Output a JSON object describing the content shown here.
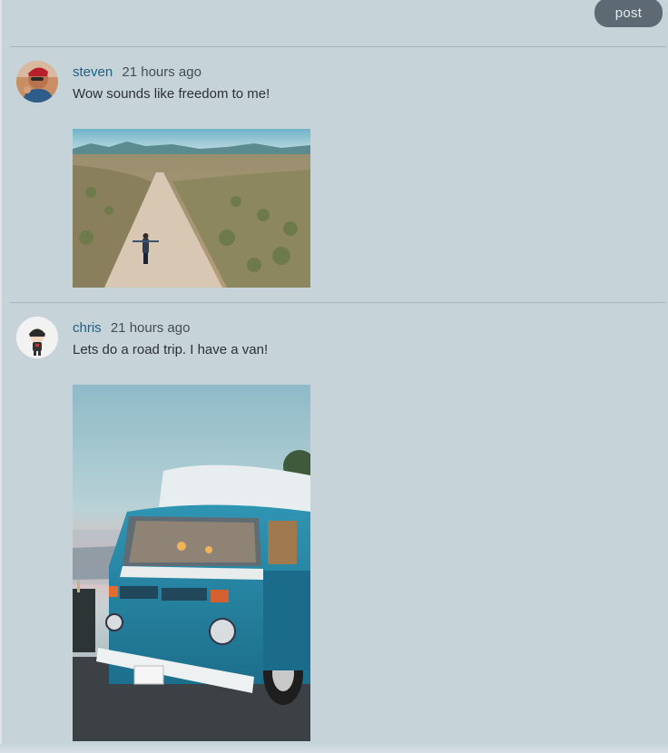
{
  "header": {
    "post_label": "post"
  },
  "posts": [
    {
      "username": "steven",
      "time": "21 hours ago",
      "text": "Wow sounds like freedom to me!",
      "image_subject": "woman walking on desert dirt road"
    },
    {
      "username": "chris",
      "time": "21 hours ago",
      "text": "Lets do a road trip. I have a van!",
      "image_subject": "blue vintage camper van at sunset"
    }
  ],
  "colors": {
    "background": "#c6d4da",
    "post_button": "#5d6a74",
    "username": "#1f5f84",
    "divider": "#a9b6bd"
  }
}
